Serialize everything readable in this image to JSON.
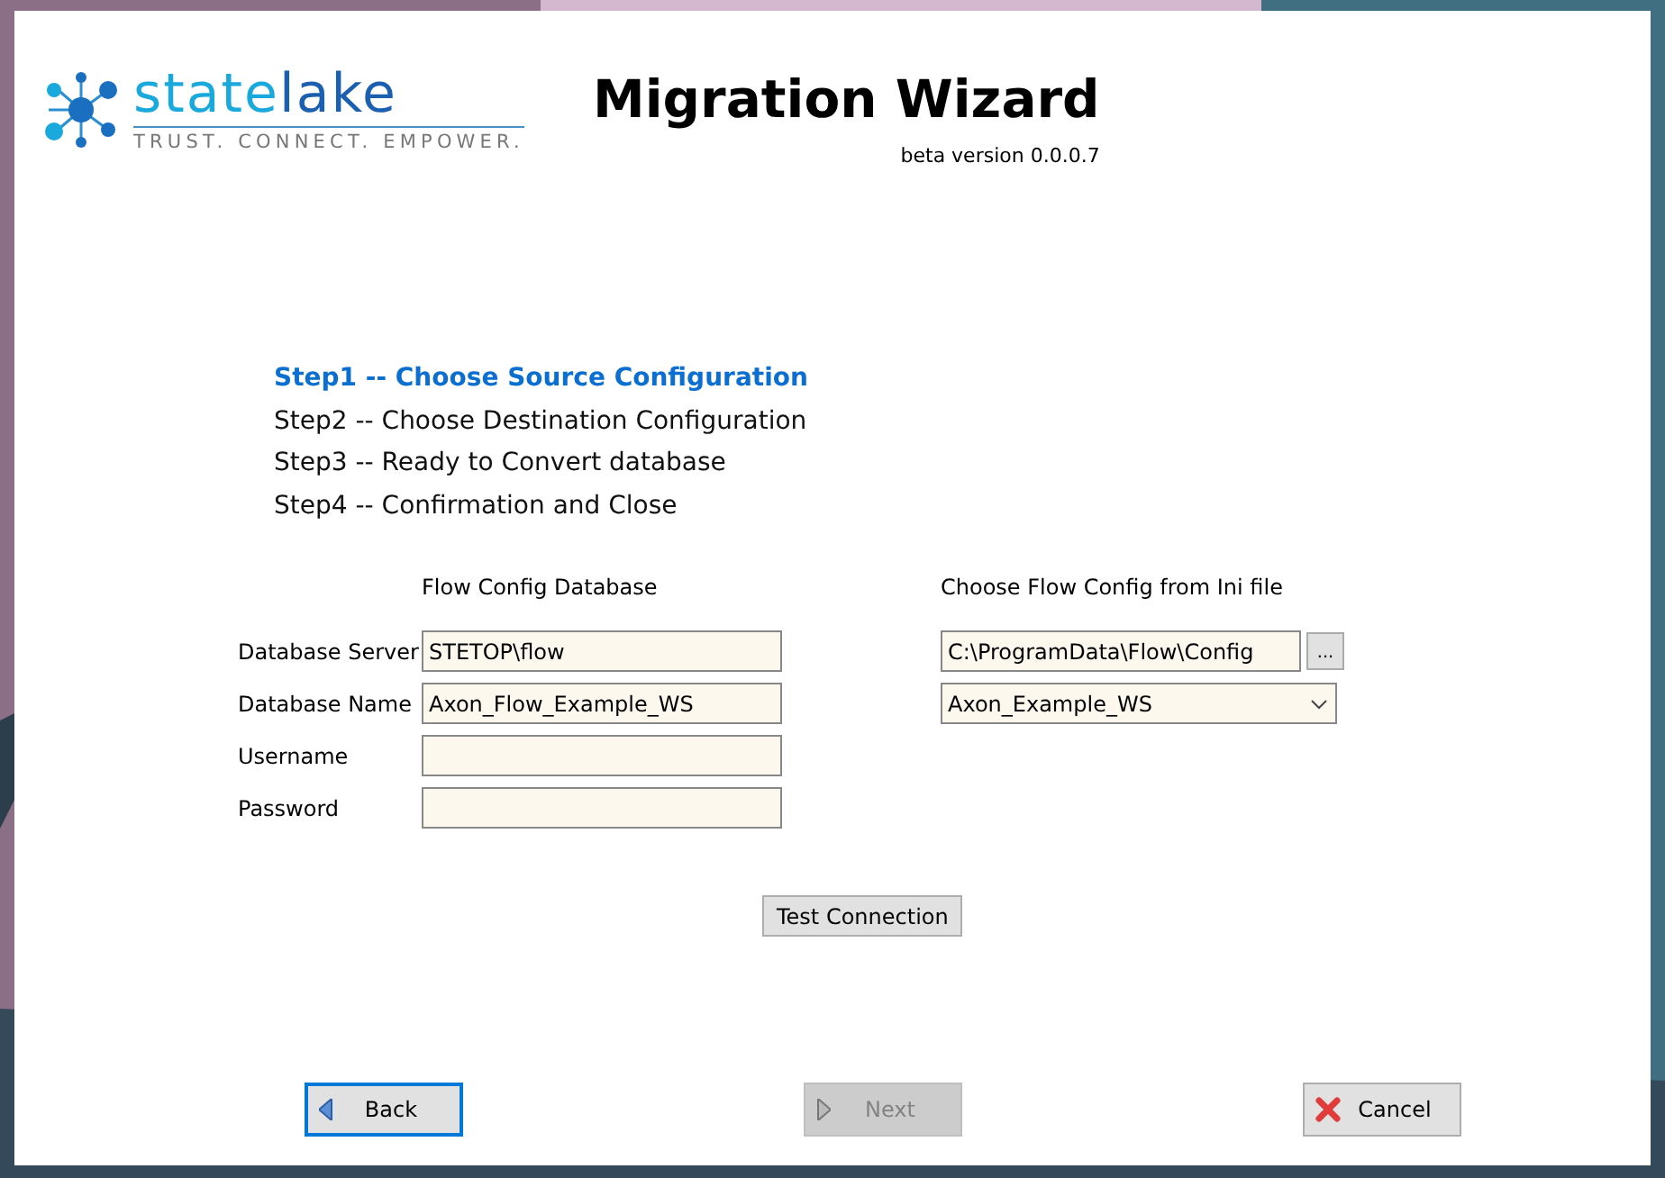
{
  "logo": {
    "name_start": "state",
    "name_end": "lake",
    "tagline": "TRUST. CONNECT. EMPOWER."
  },
  "title": "Migration Wizard",
  "version": "beta version 0.0.0.7",
  "steps": [
    {
      "label": "Step1 -- Choose Source Configuration",
      "selected": true
    },
    {
      "label": "Step2 -- Choose Destination Configuration",
      "selected": false
    },
    {
      "label": "Step3 -- Ready to Convert database",
      "selected": false
    },
    {
      "label": "Step4 -- Confirmation and Close",
      "selected": false
    }
  ],
  "database": {
    "heading": "Flow Config Database",
    "fields": [
      {
        "label": "Database Server",
        "value": "STETOP\\flow"
      },
      {
        "label": "Database Name",
        "value": "Axon_Flow_Example_WS"
      },
      {
        "label": "Username"
      },
      {
        "label": "Password"
      }
    ]
  },
  "ini": {
    "heading": "Choose Flow Config from Ini file",
    "path": "C:\\ProgramData\\Flow\\Config",
    "browse": "...",
    "config": "Axon_Example_WS"
  },
  "test_button": "Test Connection",
  "nav_buttons": [
    {
      "kind": "back",
      "label": "Back",
      "disabled": false,
      "focused": true
    },
    {
      "kind": "next",
      "label": "Next",
      "disabled": true,
      "focused": false
    },
    {
      "kind": "cancel",
      "label": "Cancel",
      "disabled": false,
      "focused": false
    }
  ]
}
